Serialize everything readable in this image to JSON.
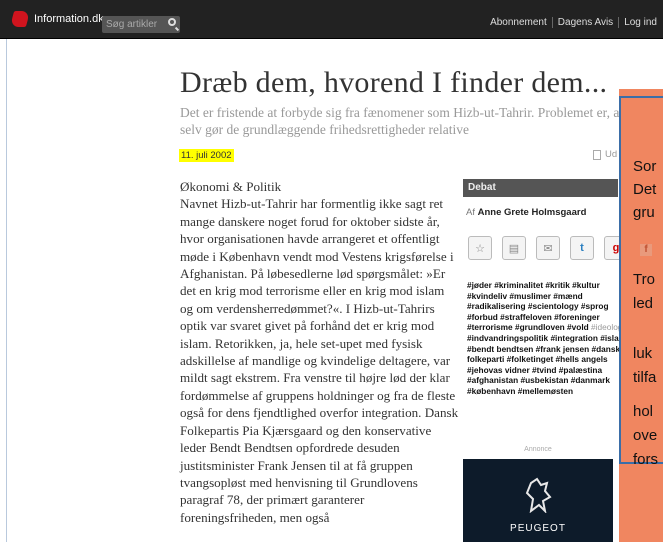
{
  "topbar": {
    "logo_text": "Information.dk",
    "search_placeholder": "Søg artikler",
    "links": [
      "Abonnement",
      "Dagens Avis",
      "Log ind"
    ]
  },
  "article": {
    "title": "Dræb dem, hvorend I finder dem...",
    "subtitle": "Det er fristende at forbyde sig fra fænomener som Hizb-ut-Tahrir. Problemet er, at vi så selv gør de grundlæggende frihedsrettigheder relative",
    "date": "11. juli 2002",
    "print_label": "Ud",
    "section": "Økonomi & Politik",
    "body": "Navnet Hizb-ut-Tahrir har formentlig ikke sagt ret mange danskere noget forud for oktober sidste år, hvor organisationen havde arrangeret et offentligt møde i København vendt mod Vestens krigsførelse i Afghanistan. På løbesedlerne lød spørgsmålet: »Er det en krig mod terrorisme eller en krig mod islam og om verdensherredømmet?«. I Hizb-ut-Tahrirs optik var svaret givet på forhånd  det er krig mod islam. Retorikken, ja, hele set-upet med fysisk adskillelse af mandlige og kvindelige deltagere, var mildt sagt ekstrem. Fra venstre til højre lød der klar fordømmelse af gruppens holdninger  og fra de fleste også for dens fjendtlighed overfor integration. Dansk Folkepartis Pia Kjærsgaard og den konservative leder Bendt Bendtsen opfordrede desuden justitsminister Frank Jensen til at få gruppen tvangsopløst med henvisning til Grundlovens paragraf 78, der primært garanterer foreningsfriheden, men også"
  },
  "sidebar": {
    "header": "Debat",
    "author_prefix": "Af",
    "author_name": "Anne Grete Holmsgaard",
    "tags_main": "#jøder #kriminalitet #kritik #kultur #kvindeliv #muslimer #mænd #radikalisering #scientology #sprog #forbud #straffeloven #foreninger #terrorisme #grundloven #vold",
    "tags_faded": "#ideologi",
    "tags_rest": "#indvandringspolitik #integration #islam #bendt bendtsen #frank jensen #dansk folkeparti #folketinget #hells angels #jehovas vidner #tvind #palæstina #afghanistan #usbekistan #danmark #københavn #mellemøsten",
    "ad_label": "Annonce",
    "ad_brand": "PEUGEOT"
  },
  "overlay": {
    "lines": [
      "Sor",
      "Det",
      "gru",
      "Tro",
      "led",
      "luk",
      "tilfa",
      "hol",
      "ove",
      "fors"
    ],
    "color": "#f08660",
    "border_color": "#3b6ea8"
  }
}
